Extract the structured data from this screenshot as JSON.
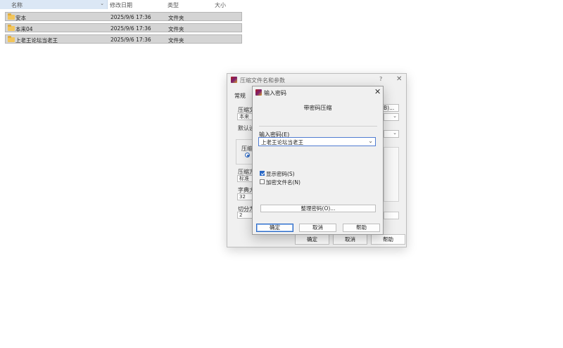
{
  "explorer": {
    "columns": {
      "name": "名称",
      "date": "修改日期",
      "type": "类型",
      "size": "大小"
    },
    "rows": [
      {
        "name": "安本",
        "date": "2025/9/6 17:36",
        "type": "文件夹"
      },
      {
        "name": "本来04",
        "date": "2025/9/6 17:36",
        "type": "文件夹"
      },
      {
        "name": "上老王论坛当老王",
        "date": "2025/9/6 17:36",
        "type": "文件夹"
      }
    ]
  },
  "archive_dialog": {
    "title": "压缩文件名和参数",
    "help_glyph": "?",
    "close_glyph": "✕",
    "tab_general": "常规",
    "labels": {
      "archive_name": "压缩文",
      "default": "默认设",
      "archive_format": "压缩",
      "compression_method": "压缩方",
      "dictionary_size": "字典大",
      "split": "切分为"
    },
    "archive_name_value": "本来04",
    "compression_method_value": "标准",
    "dictionary_value": "32",
    "split_value": "2",
    "browse_label": "B)...",
    "buttons": {
      "ok": "确定",
      "cancel": "取消",
      "help": "帮助"
    }
  },
  "password_dialog": {
    "title": "输入密码",
    "close_glyph": "✕",
    "subtitle": "带密码压缩",
    "password_label": "输入密码(E)",
    "password_value": "上老王论坛当老王",
    "show_password": {
      "label": "显示密码(S)",
      "checked": true
    },
    "encrypt_filenames": {
      "label": "加密文件名(N)",
      "checked": false
    },
    "organize_button": "整理密码(O)...",
    "buttons": {
      "ok": "确定",
      "cancel": "取消",
      "help": "帮助"
    }
  },
  "colors": {
    "accent": "#2a68c5",
    "header_highlight": "#dbe7f5",
    "row_selected": "#d4d4d4",
    "folder": "#f2c55c"
  }
}
